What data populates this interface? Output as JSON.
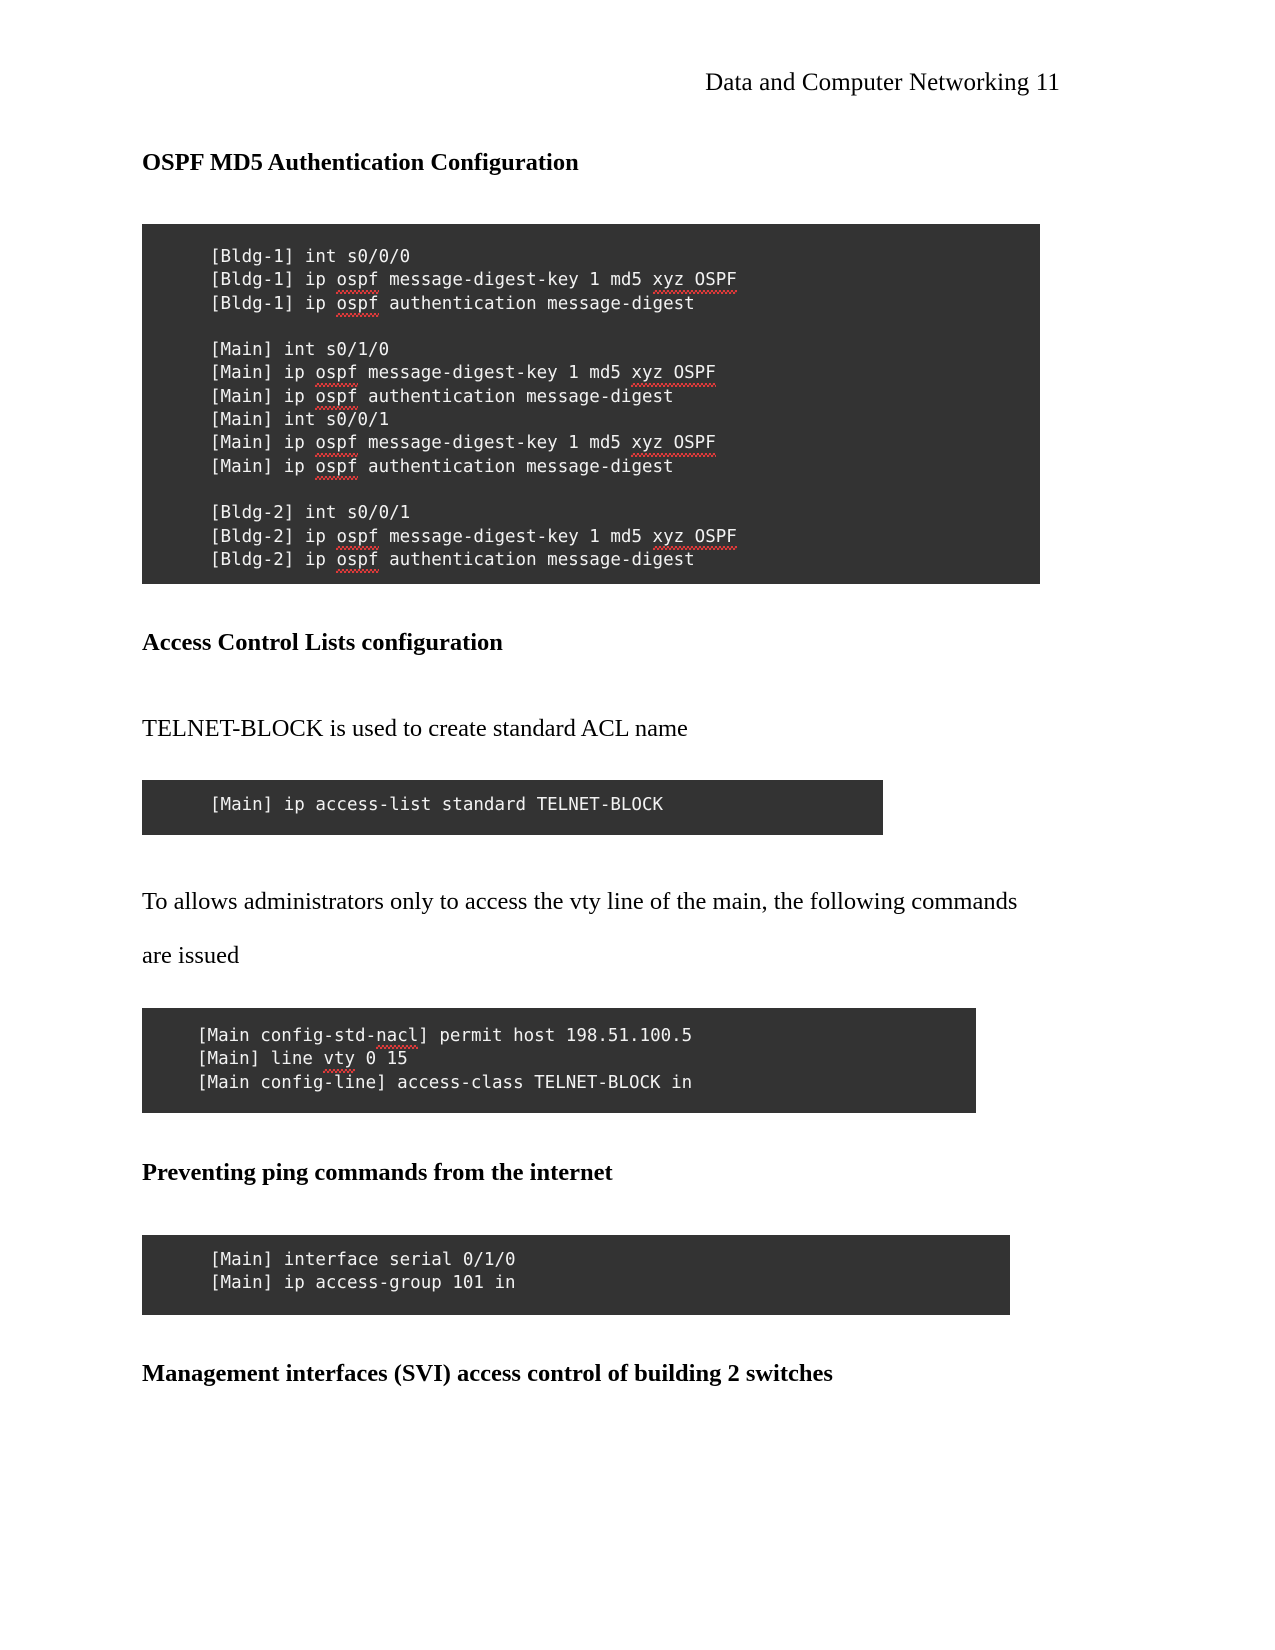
{
  "header": {
    "title": "Data and Computer Networking 11"
  },
  "sections": {
    "heading_ospf": "OSPF MD5 Authentication Configuration",
    "heading_acl": "Access Control Lists configuration",
    "para_telnet": "TELNET-BLOCK is used to create standard ACL name",
    "para_vty": "To allows administrators only to access the vty line of the main, the following commands are issued",
    "heading_ping": "Preventing ping commands from the internet",
    "heading_svi": "Management interfaces (SVI) access control of building 2 switches"
  },
  "code_blocks": {
    "ospf": {
      "lines": [
        "[Bldg-1] int s0/0/0",
        "[Bldg-1] ip ospf message-digest-key 1 md5 xyz OSPF",
        "[Bldg-1] ip ospf authentication message-digest",
        "",
        "[Main] int s0/1/0",
        "[Main] ip ospf message-digest-key 1 md5 xyz OSPF",
        "[Main] ip ospf authentication message-digest",
        "[Main] int s0/0/1",
        "[Main] ip ospf message-digest-key 1 md5 xyz OSPF",
        "[Main] ip ospf authentication message-digest",
        "",
        "[Bldg-2] int s0/0/1",
        "[Bldg-2] ip ospf message-digest-key 1 md5 xyz OSPF",
        "[Bldg-2] ip ospf authentication message-digest"
      ]
    },
    "acl_name": {
      "lines": [
        "[Main] ip access-list standard TELNET-BLOCK"
      ]
    },
    "vty": {
      "lines": [
        "[Main config-std-nacl] permit host 198.51.100.5",
        "[Main] line vty 0 15",
        "[Main config-line] access-class TELNET-BLOCK in"
      ]
    },
    "ping": {
      "lines": [
        "[Main] interface serial 0/1/0",
        "[Main] ip access-group 101 in"
      ]
    }
  },
  "colors": {
    "code_background": "#333333",
    "code_text": "#f2f2f2",
    "spellcheck_underline": "#e03a3a",
    "page_background": "#ffffff",
    "body_text": "#000000"
  }
}
